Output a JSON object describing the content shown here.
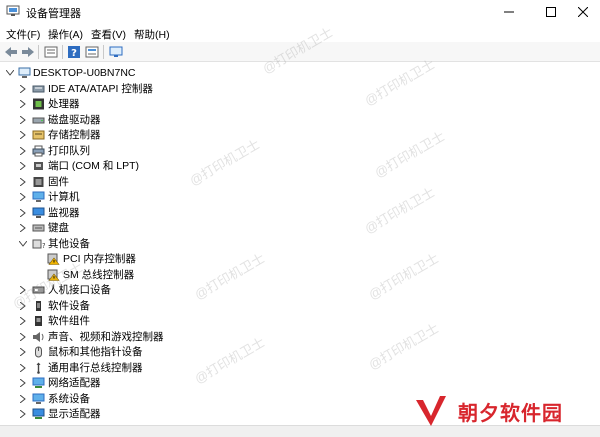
{
  "window": {
    "title": "设备管理器",
    "controls": {
      "minimize": "minimize-icon",
      "maximize": "maximize-icon",
      "close": "close-icon"
    }
  },
  "menubar": {
    "items": [
      "文件(F)",
      "操作(A)",
      "查看(V)",
      "帮助(H)"
    ]
  },
  "toolbar": {
    "buttons": [
      "back-icon",
      "forward-icon",
      "properties-icon",
      "help-icon",
      "view-icon",
      "monitor-icon"
    ]
  },
  "tree": {
    "root": "DESKTOP-U0BN7NC",
    "items": [
      {
        "label": "IDE ATA/ATAPI 控制器",
        "icon": "ide-controller-icon",
        "expanded": false
      },
      {
        "label": "处理器",
        "icon": "processor-icon",
        "expanded": false
      },
      {
        "label": "磁盘驱动器",
        "icon": "disk-drive-icon",
        "expanded": false
      },
      {
        "label": "存储控制器",
        "icon": "storage-controller-icon",
        "expanded": false
      },
      {
        "label": "打印队列",
        "icon": "printer-icon",
        "expanded": false
      },
      {
        "label": "端口 (COM 和 LPT)",
        "icon": "port-icon",
        "expanded": false
      },
      {
        "label": "固件",
        "icon": "firmware-icon",
        "expanded": false
      },
      {
        "label": "计算机",
        "icon": "computer-icon",
        "expanded": false
      },
      {
        "label": "监视器",
        "icon": "monitor-icon",
        "expanded": false
      },
      {
        "label": "键盘",
        "icon": "keyboard-icon",
        "expanded": false
      },
      {
        "label": "其他设备",
        "icon": "other-devices-icon",
        "expanded": true,
        "children": [
          {
            "label": "PCI 内存控制器",
            "icon": "warning-device-icon"
          },
          {
            "label": "SM 总线控制器",
            "icon": "warning-device-icon"
          }
        ]
      },
      {
        "label": "人机接口设备",
        "icon": "hid-icon",
        "expanded": false
      },
      {
        "label": "软件设备",
        "icon": "software-device-icon",
        "expanded": false
      },
      {
        "label": "软件组件",
        "icon": "software-component-icon",
        "expanded": false
      },
      {
        "label": "声音、视频和游戏控制器",
        "icon": "sound-icon",
        "expanded": false
      },
      {
        "label": "鼠标和其他指针设备",
        "icon": "mouse-icon",
        "expanded": false
      },
      {
        "label": "通用串行总线控制器",
        "icon": "usb-icon",
        "expanded": false
      },
      {
        "label": "网络适配器",
        "icon": "network-adapter-icon",
        "expanded": false
      },
      {
        "label": "系统设备",
        "icon": "system-device-icon",
        "expanded": false
      },
      {
        "label": "显示适配器",
        "icon": "display-adapter-icon",
        "expanded": false
      }
    ]
  },
  "watermark": {
    "text": "@打印机卫士"
  },
  "brand": {
    "name": "朝夕软件园",
    "color": "#d8262d"
  },
  "colors": {
    "accent": "#0078d7",
    "warning": "#f0b400"
  }
}
